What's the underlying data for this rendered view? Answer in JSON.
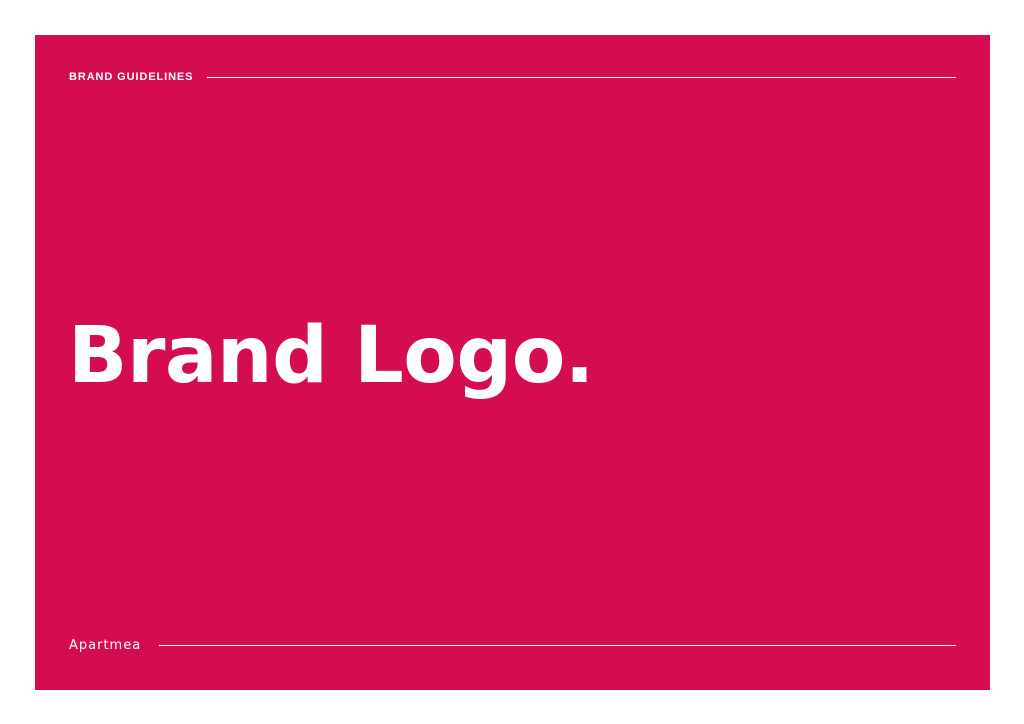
{
  "header": {
    "label": "BRAND GUIDELINES"
  },
  "main": {
    "title": "Brand Logo."
  },
  "footer": {
    "logo_text": "Apartmea"
  },
  "colors": {
    "background": "#d40e4e",
    "text": "#ffffff",
    "page": "#ffffff"
  }
}
